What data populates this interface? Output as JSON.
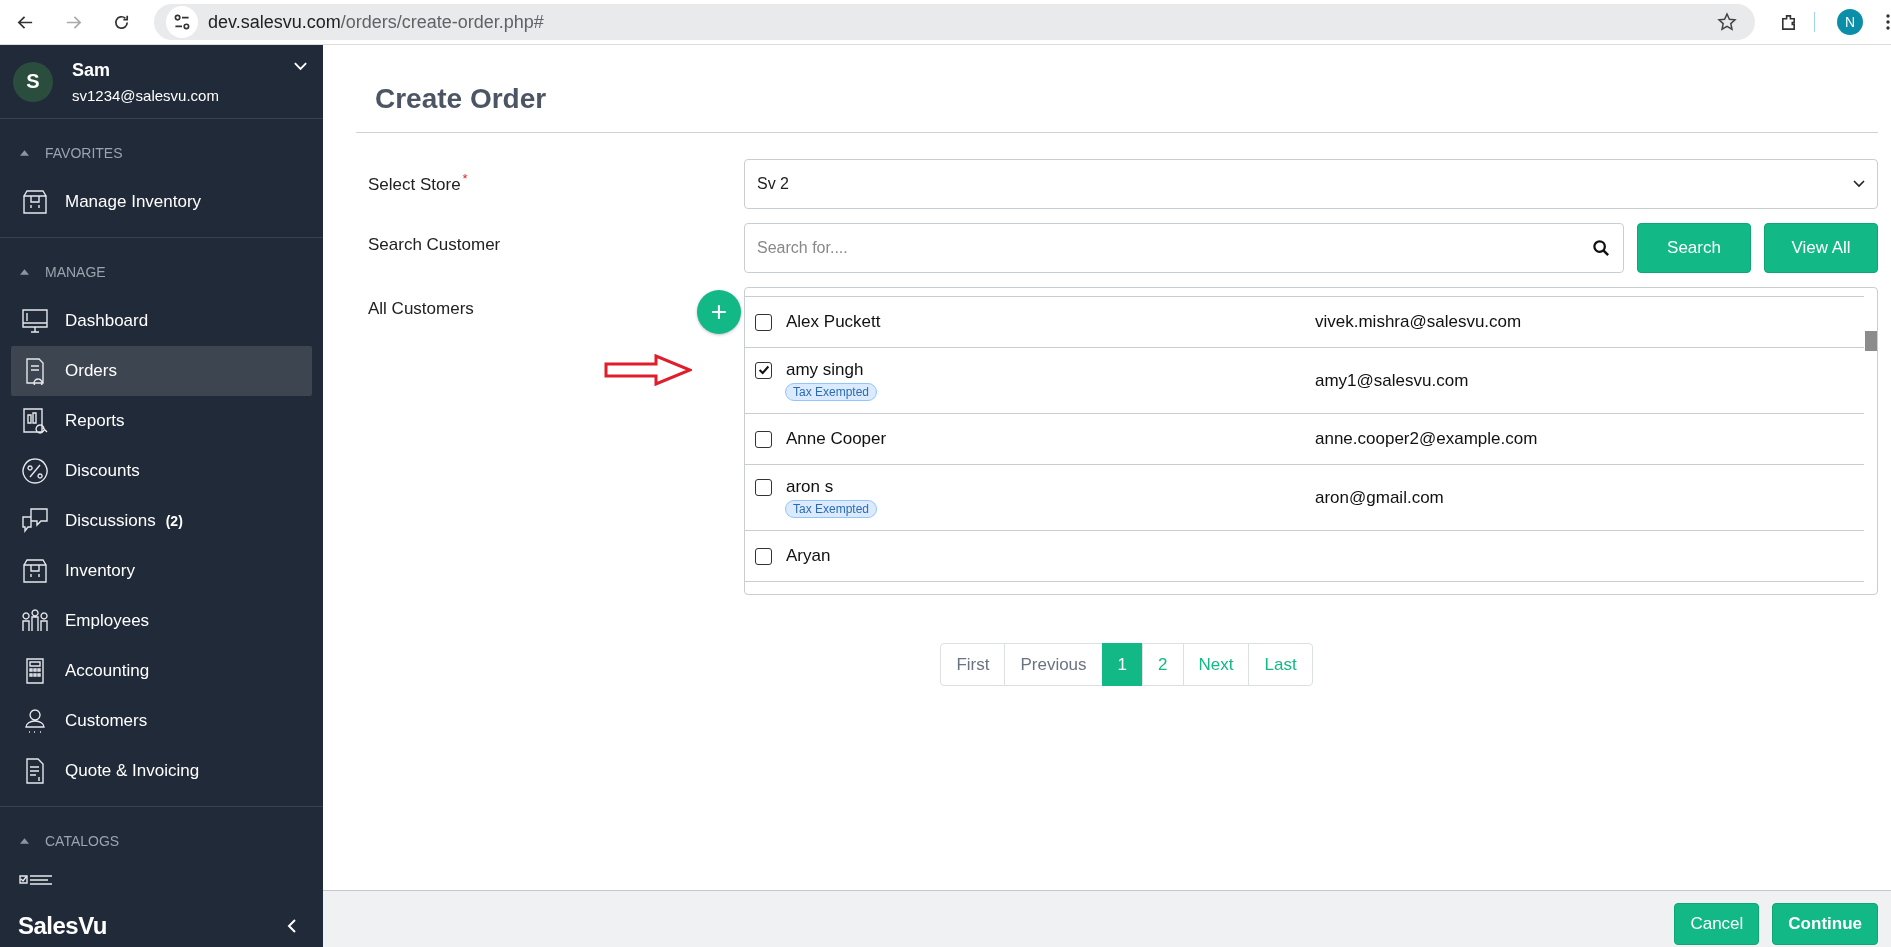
{
  "browser": {
    "url_host": "dev.salesvu.com",
    "url_path": "/orders/create-order.php#",
    "profile_initial": "N"
  },
  "sidebar": {
    "user": {
      "initial": "S",
      "name": "Sam",
      "email": "sv1234@salesvu.com"
    },
    "sections": [
      {
        "title": "FAVORITES",
        "expanded": true,
        "items": [
          {
            "label": "Manage Inventory",
            "selected": false
          }
        ]
      },
      {
        "title": "MANAGE",
        "expanded": true,
        "items": [
          {
            "label": "Dashboard",
            "selected": false
          },
          {
            "label": "Orders",
            "selected": true
          },
          {
            "label": "Reports",
            "selected": false
          },
          {
            "label": "Discounts",
            "selected": false
          },
          {
            "label": "Discussions",
            "badge": "(2)",
            "selected": false
          },
          {
            "label": "Inventory",
            "selected": false
          },
          {
            "label": "Employees",
            "selected": false
          },
          {
            "label": "Accounting",
            "selected": false
          },
          {
            "label": "Customers",
            "selected": false
          },
          {
            "label": "Quote & Invoicing",
            "selected": false
          }
        ]
      },
      {
        "title": "CATALOGS",
        "expanded": true
      }
    ],
    "logo": "SalesVu"
  },
  "page": {
    "title": "Create Order",
    "store": {
      "label": "Select Store",
      "required_mark": "*",
      "value": "Sv 2"
    },
    "search": {
      "label": "Search Customer",
      "placeholder": "Search for....",
      "buttons": [
        "Search",
        "View All"
      ]
    },
    "customers_label": "All Customers",
    "add_button": "+",
    "customers": [
      {
        "name": "Alex Puckett",
        "email": "vivek.mishra@salesvu.com",
        "checked": false
      },
      {
        "name": "amy singh",
        "badge": "Tax Exempted",
        "email": "amy1@salesvu.com",
        "checked": true
      },
      {
        "name": "Anne Cooper",
        "email": "anne.cooper2@example.com",
        "checked": false
      },
      {
        "name": "aron s",
        "badge": "Tax Exempted",
        "email": "aron@gmail.com",
        "checked": false
      },
      {
        "name": "Aryan",
        "checked": false
      }
    ],
    "pagination": [
      {
        "label": "First",
        "selected": false,
        "disabled": true
      },
      {
        "label": "Previous",
        "selected": false,
        "disabled": true
      },
      {
        "label": "1",
        "selected": true,
        "disabled": false
      },
      {
        "label": "2",
        "selected": false,
        "disabled": false
      },
      {
        "label": "Next",
        "selected": false,
        "disabled": false
      },
      {
        "label": "Last",
        "selected": false,
        "disabled": false
      }
    ]
  },
  "footer": {
    "buttons": [
      "Cancel",
      "Continue"
    ]
  }
}
